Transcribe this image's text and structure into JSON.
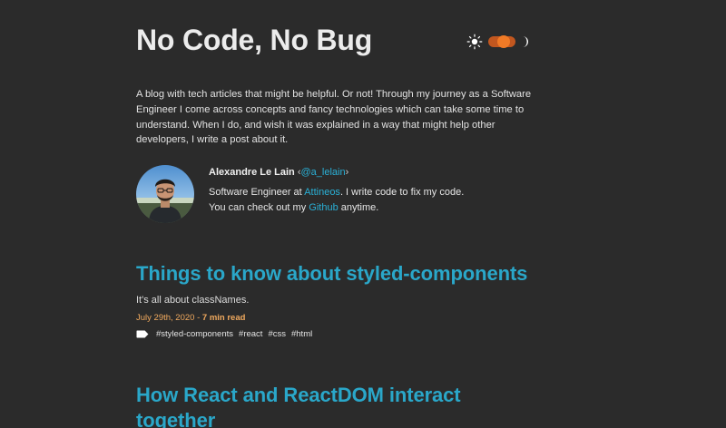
{
  "site": {
    "title": "No Code, No Bug"
  },
  "theme_toggle": {
    "sun_icon": "sun-icon",
    "moon_icon": "moon-icon",
    "state": "dark",
    "track_color": "#c2571f",
    "thumb_color": "#f07a26"
  },
  "intro": {
    "text": "A blog with tech articles that might be helpful. Or not! Through my journey as a Software Engineer I come across concepts and fancy technologies which can take some time to understand. When I do, and wish it was explained in a way that might help other developers, I write a post about it."
  },
  "bio": {
    "name": "Alexandre Le Lain",
    "handle_open": " ‹",
    "handle": "@a_lelain",
    "handle_close": "›",
    "line2_prefix": "Software Engineer at ",
    "company": "Attineos",
    "line2_suffix": ". I write code to fix my code.",
    "line3_prefix": "You can check out my ",
    "github": "Github",
    "line3_suffix": " anytime."
  },
  "posts": [
    {
      "title": "Things to know about styled-components",
      "excerpt": "It's all about classNames.",
      "date": "July 29th, 2020",
      "separator": " - ",
      "read_time": "7 min read",
      "tag_icon": "tag-icon",
      "tags": [
        "#styled-components",
        "#react",
        "#css",
        "#html"
      ]
    },
    {
      "title": "How React and ReactDOM interact together"
    }
  ],
  "colors": {
    "background": "#2b2b2b",
    "accent": "#2aa7c9",
    "date": "#f0a95e"
  }
}
